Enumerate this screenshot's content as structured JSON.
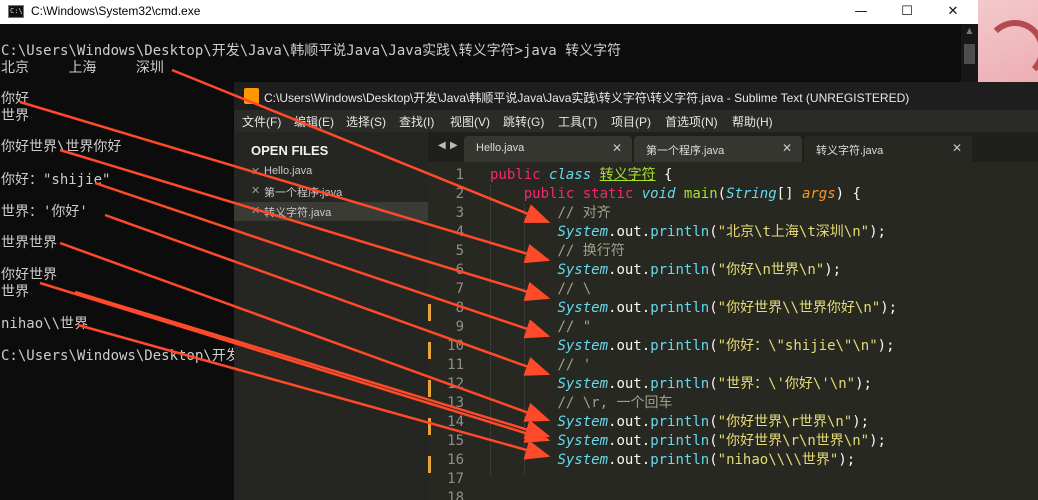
{
  "colors": {
    "arrow": "#ff4a2a",
    "editor_bg": "#272822",
    "cmd_bg": "#0c0c0c"
  },
  "cmd": {
    "title": "C:\\Windows\\System32\\cmd.exe",
    "icon": "cmd-icon",
    "icon_text": "C:\\",
    "minimize_glyph": "—",
    "maximize_glyph": "☐",
    "close_glyph": "✕",
    "lines": [
      "C:\\Users\\Windows\\Desktop\\开发\\Java\\韩顺平说Java\\Java实践\\转义字符>java 转义字符",
      "北京\t上海\t深圳",
      "你好",
      "世界",
      "你好世界\\世界你好",
      "你好：\"shijie\"",
      "世界：'你好'",
      "世界世界",
      "你好世界",
      "世界",
      "nihao\\\\世界",
      "C:\\Users\\Windows\\Desktop\\开发"
    ]
  },
  "sublime": {
    "title": "C:\\Users\\Windows\\Desktop\\开发\\Java\\韩顺平说Java\\Java实践\\转义字符\\转义字符.java - Sublime Text (UNREGISTERED)",
    "menu": [
      "文件(F)",
      "编辑(E)",
      "选择(S)",
      "查找(I)",
      "视图(V)",
      "跳转(G)",
      "工具(T)",
      "项目(P)",
      "首选项(N)",
      "帮助(H)"
    ],
    "sidebar": {
      "header": "OPEN FILES",
      "files": [
        "Hello.java",
        "第一个程序.java",
        "转义字符.java"
      ]
    },
    "tabs": [
      "Hello.java",
      "第一个程序.java",
      "转义字符.java"
    ],
    "tab_nav": {
      "left": "◀",
      "right": "▶"
    },
    "close_glyph": "✕",
    "line_numbers": [
      "1",
      "2",
      "3",
      "4",
      "5",
      "6",
      "7",
      "8",
      "9",
      "10",
      "11",
      "12",
      "13",
      "14",
      "15",
      "16",
      "17",
      "18"
    ],
    "code": {
      "l1": {
        "kw": "public",
        "kw2": "class",
        "name": "转义字符",
        "brace": " {"
      },
      "l2": {
        "kw": "public",
        "kw2": "static",
        "ret": "void",
        "fn": "main",
        "p1": "(",
        "type": "String",
        "p2": "[] ",
        "arg": "args",
        "p3": ") {"
      },
      "comments": [
        "// 对齐",
        "// 换行符",
        "// \\",
        "// \"",
        "// '",
        "// \\r, 一个回车"
      ],
      "prints": [
        "\"北京\\t上海\\t深圳\\n\"",
        "\"你好\\n世界\\n\"",
        "\"你好世界\\\\世界你好\\n\"",
        "\"你好：\\\"shijie\\\"\\n\"",
        "\"世界：\\'你好\\'\\n\"",
        "\"你好世界\\r世界\\n\"",
        "\"你好世界\\r\\n世界\\n\"",
        "\"nihao\\\\\\\\世界\""
      ],
      "sys": "System",
      "dot": ".",
      "out": "out",
      "println": "println",
      "lp": "(",
      "rp": ");"
    }
  }
}
